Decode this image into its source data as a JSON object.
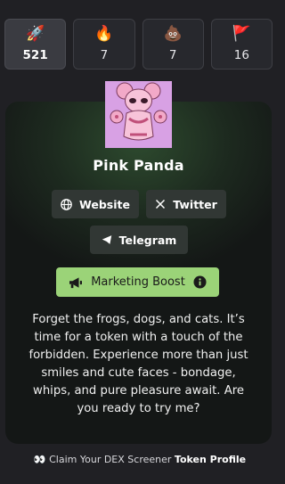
{
  "stats": [
    {
      "icon": "rocket-icon",
      "emoji": "🚀",
      "count": "521",
      "active": true
    },
    {
      "icon": "fire-icon",
      "emoji": "🔥",
      "count": "7",
      "active": false
    },
    {
      "icon": "poop-icon",
      "emoji": "💩",
      "count": "7",
      "active": false
    },
    {
      "icon": "flag-icon",
      "emoji": "🚩",
      "count": "16",
      "active": false
    }
  ],
  "token": {
    "name": "Pink Panda"
  },
  "links": {
    "website": "Website",
    "twitter": "Twitter",
    "telegram": "Telegram"
  },
  "boost": {
    "label": "Marketing Boost"
  },
  "description": "Forget the frogs, dogs, and cats. It’s time for a token with a touch of the forbidden. Experience more than just smiles and cute faces - bondage, whips, and pure pleasure await. Are you ready to try me?",
  "footer": {
    "emoji": "👀",
    "prefix": "Claim Your DEX Screener",
    "bold": "Token Profile"
  },
  "colors": {
    "accent": "#9bd378",
    "card_glow": "#2d4a2e",
    "avatar_bg": "#d8a1e4"
  }
}
